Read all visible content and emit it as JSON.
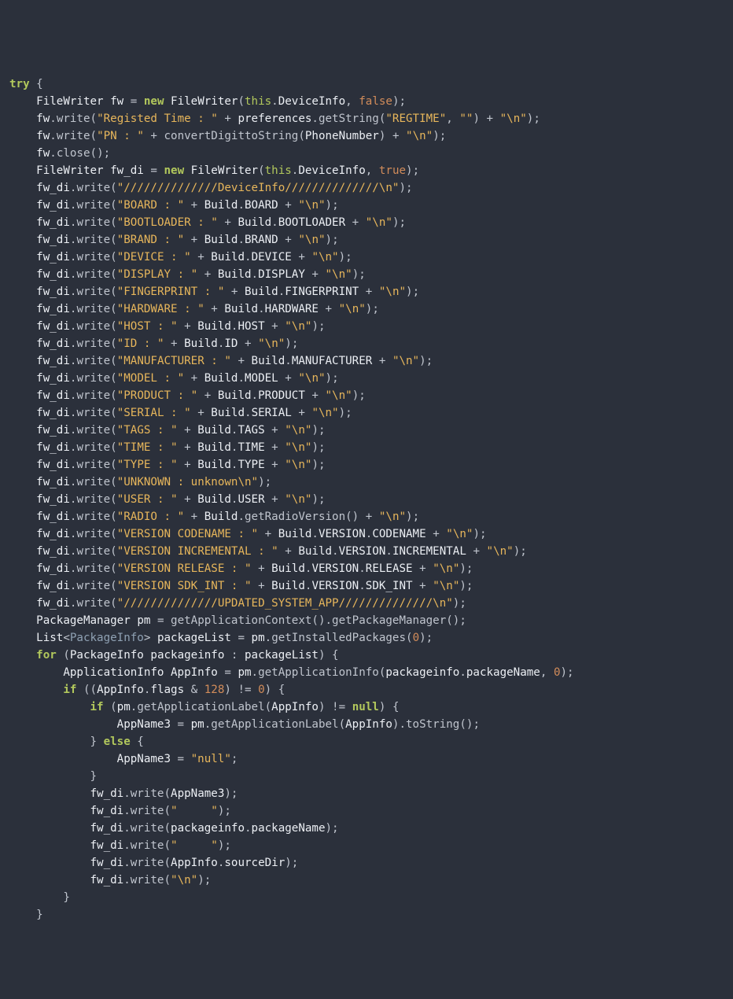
{
  "tokens": {
    "try": "try",
    "new": "new",
    "false": "false",
    "true": "true",
    "thisKw": "this",
    "forKw": "for",
    "ifKw": "if",
    "elseKw": "else",
    "nullKw": "null",
    "FileWriter": "FileWriter",
    "PackageManager": "PackageManager",
    "PackageInfo": "PackageInfo",
    "ApplicationInfo": "ApplicationInfo",
    "List": "List",
    "fw": "fw",
    "fw_di": "fw_di",
    "DeviceInfo": "DeviceInfo",
    "preferences": "preferences",
    "getString": "getString",
    "convertDigittoString": "convertDigittoString",
    "PhoneNumber": "PhoneNumber",
    "Build": "Build",
    "BOARD": "BOARD",
    "BOOTLOADER": "BOOTLOADER",
    "BRAND": "BRAND",
    "DEVICE": "DEVICE",
    "DISPLAY": "DISPLAY",
    "FINGERPRINT": "FINGERPRINT",
    "HARDWARE": "HARDWARE",
    "HOST": "HOST",
    "ID": "ID",
    "MANUFACTURER": "MANUFACTURER",
    "MODEL": "MODEL",
    "PRODUCT": "PRODUCT",
    "SERIAL": "SERIAL",
    "TAGS": "TAGS",
    "TIME": "TIME",
    "TYPE": "TYPE",
    "USER": "USER",
    "getRadioVersion": "getRadioVersion",
    "VERSION": "VERSION",
    "CODENAME": "CODENAME",
    "INCREMENTAL": "INCREMENTAL",
    "RELEASE": "RELEASE",
    "SDK_INT": "SDK_INT",
    "pm": "pm",
    "getApplicationContext": "getApplicationContext",
    "getPackageManager": "getPackageManager",
    "packageList": "packageList",
    "getInstalledPackages": "getInstalledPackages",
    "packageinfo": "packageinfo",
    "AppInfo": "AppInfo",
    "getApplicationInfo": "getApplicationInfo",
    "packageName": "packageName",
    "flags": "flags",
    "getApplicationLabel": "getApplicationLabel",
    "AppName3": "AppName3",
    "toString": "toString",
    "sourceDir": "sourceDir",
    "write": "write",
    "close": "close",
    "n128": "128",
    "n0": "0"
  },
  "strings": {
    "registed": "\"Registed Time : \"",
    "regtime": "\"REGTIME\"",
    "empty": "\"\"",
    "nl": "\"\\n\"",
    "pn": "\"PN : \"",
    "devInfoHdr": "\"//////////////DeviceInfo//////////////\\n\"",
    "board": "\"BOARD : \"",
    "bootloader": "\"BOOTLOADER : \"",
    "brand": "\"BRAND : \"",
    "device": "\"DEVICE : \"",
    "display": "\"DISPLAY : \"",
    "fingerprint": "\"FINGERPRINT : \"",
    "hardware": "\"HARDWARE : \"",
    "host": "\"HOST : \"",
    "idStr": "\"ID : \"",
    "manufacturer": "\"MANUFACTURER : \"",
    "model": "\"MODEL : \"",
    "product": "\"PRODUCT : \"",
    "serial": "\"SERIAL : \"",
    "tags": "\"TAGS : \"",
    "time": "\"TIME : \"",
    "type": "\"TYPE : \"",
    "unknown": "\"UNKNOWN : unknown\\n\"",
    "user": "\"USER : \"",
    "radio": "\"RADIO : \"",
    "vCodename": "\"VERSION CODENAME : \"",
    "vIncremental": "\"VERSION INCREMENTAL : \"",
    "vRelease": "\"VERSION RELEASE : \"",
    "vSdkInt": "\"VERSION SDK_INT : \"",
    "updHdr": "\"//////////////UPDATED_SYSTEM_APP//////////////\\n\"",
    "nullStr": "\"null\"",
    "spaces": "\"     \""
  }
}
